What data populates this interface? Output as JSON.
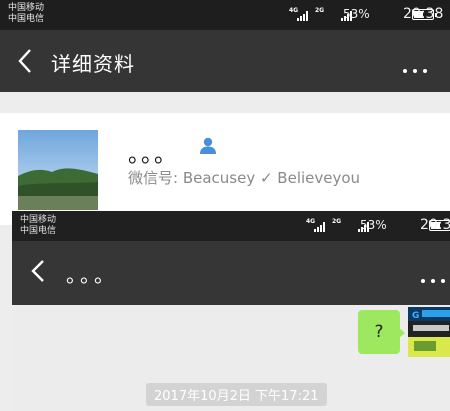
{
  "status_bar": {
    "carrier_1": "中国移动",
    "carrier_2": "中国电信",
    "net_1": "4G",
    "net_2": "2G",
    "battery": "53%",
    "time": "20:38"
  },
  "nav": {
    "back_icon": "chevron-left-icon",
    "title": "详细资料",
    "more_icon": "more-dots-icon"
  },
  "profile": {
    "name": "。。。",
    "gender_icon": "person-icon",
    "gender_color": "#4a90d9",
    "wechat_id": "微信号: Beacusey ✓ Believeyou"
  },
  "overlay": {
    "status_bar": {
      "carrier_1": "中国移动",
      "carrier_2": "中国电信",
      "net_1": "4G",
      "net_2": "2G",
      "battery": "53%",
      "time": "20:3"
    },
    "nav": {
      "back_icon": "chevron-left-icon",
      "title": "。。。",
      "more_icon": "more-dots-icon"
    },
    "chat": {
      "message": "?",
      "bubble_color": "#9de85f",
      "timestamp": "2017年10月2日 下午17:21"
    }
  }
}
